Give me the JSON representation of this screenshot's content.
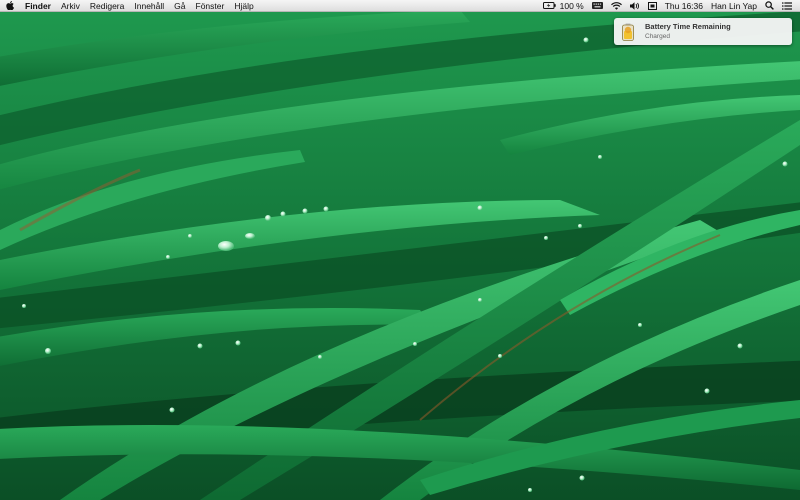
{
  "menubar": {
    "apple_icon": "apple-logo-icon",
    "app_name": "Finder",
    "menus": [
      "Arkiv",
      "Redigera",
      "Innehåll",
      "Gå",
      "Fönster",
      "Hjälp"
    ],
    "battery_percent": "100 %",
    "datetime": "Thu 16:36",
    "user_name": "Han Lin Yap",
    "status_icons": [
      "battery-icon",
      "keyboard-input-icon",
      "wifi-icon",
      "volume-icon",
      "display-icon",
      "spotlight-search-icon",
      "notification-center-icon"
    ]
  },
  "notification": {
    "icon": "battery-time-app-icon",
    "title": "Battery Time Remaining",
    "subtitle": "Charged"
  },
  "desktop": {
    "wallpaper": "grass-with-water-drops"
  },
  "colors": {
    "grass_dark": "#0a4a22",
    "grass_mid": "#1a8a45",
    "grass_light": "#3cc06a"
  }
}
